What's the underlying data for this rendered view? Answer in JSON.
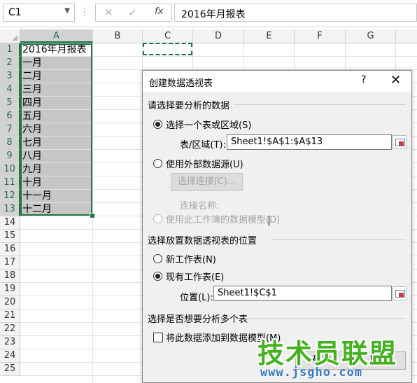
{
  "formula_bar": {
    "name_box": "C1",
    "cancel_icon": "✕",
    "enter_icon": "✓",
    "fx_label": "fx",
    "formula_value": "2016年月报表"
  },
  "columns": [
    "A",
    "B",
    "C",
    "D",
    "E",
    "F",
    "G"
  ],
  "rows": [
    "1",
    "2",
    "3",
    "4",
    "5",
    "6",
    "7",
    "8",
    "9",
    "10",
    "11",
    "12",
    "13",
    "14",
    "15",
    "16",
    "17",
    "18",
    "19",
    "20",
    "21",
    "22",
    "23",
    "24",
    "25"
  ],
  "cells_A": [
    "2016年月报表",
    "一月",
    "二月",
    "三月",
    "四月",
    "五月",
    "六月",
    "七月",
    "八月",
    "九月",
    "十月",
    "十一月",
    "十二月"
  ],
  "dialog": {
    "title": "创建数据透视表",
    "help_label": "?",
    "close_label": "✕",
    "section1": "请选择要分析的数据",
    "opt_table_range": "选择一个表或区域(S)",
    "table_range_label": "表/区域(T):",
    "table_range_value": "Sheet1!$A$1:$A$13",
    "opt_external": "使用外部数据源(U)",
    "choose_connection": "选择连接(C)...",
    "connection_name_label": "连接名称:",
    "opt_data_model": "使用此工作簿的数据模型(D)",
    "section2": "选择放置数据透视表的位置",
    "opt_new_sheet": "新工作表(N)",
    "opt_existing_sheet": "现有工作表(E)",
    "location_label": "位置(L):",
    "location_value": "Sheet1!$C$1",
    "section3": "选择是否想要分析多个表",
    "add_to_model": "将此数据添加到数据模型(M)",
    "ok_label": "确定",
    "cancel_label": "取消"
  },
  "watermark": {
    "brand": "技术员联盟",
    "url": "www.jsgho.com"
  },
  "colors": {
    "accent": "#217346",
    "selection_shade": "#c6c6c6"
  }
}
